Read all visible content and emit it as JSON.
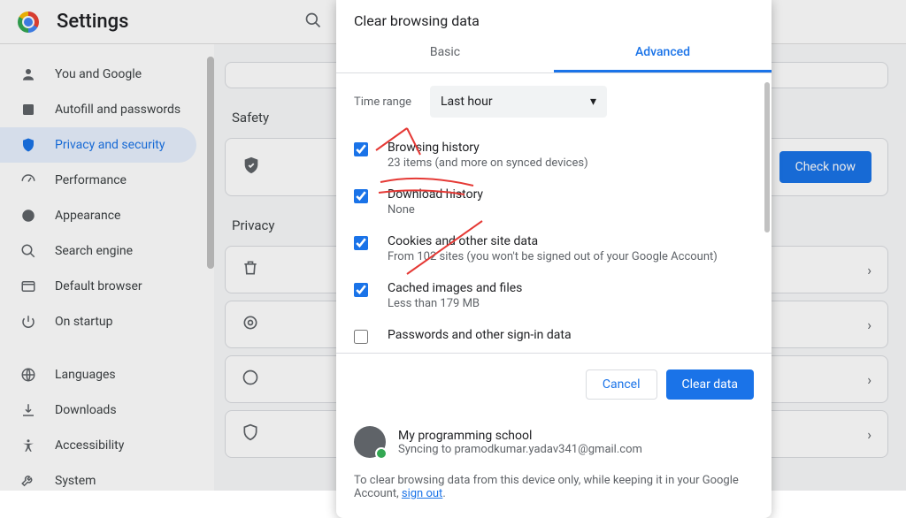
{
  "header": {
    "title": "Settings"
  },
  "sidebar": {
    "items": [
      {
        "label": "You and Google"
      },
      {
        "label": "Autofill and passwords"
      },
      {
        "label": "Privacy and security"
      },
      {
        "label": "Performance"
      },
      {
        "label": "Appearance"
      },
      {
        "label": "Search engine"
      },
      {
        "label": "Default browser"
      },
      {
        "label": "On startup"
      },
      {
        "label": "Languages"
      },
      {
        "label": "Downloads"
      },
      {
        "label": "Accessibility"
      },
      {
        "label": "System"
      }
    ]
  },
  "content": {
    "safety_label": "Safety",
    "check_now": "Check now",
    "privacy_label": "Privacy"
  },
  "modal": {
    "title": "Clear browsing data",
    "tab_basic": "Basic",
    "tab_advanced": "Advanced",
    "time_label": "Time range",
    "time_selected": "Last hour",
    "options": [
      {
        "label": "Browsing history",
        "sub": "23 items (and more on synced devices)",
        "checked": true
      },
      {
        "label": "Download history",
        "sub": "None",
        "checked": true
      },
      {
        "label": "Cookies and other site data",
        "sub": "From 102 sites (you won't be signed out of your Google Account)",
        "checked": true
      },
      {
        "label": "Cached images and files",
        "sub": "Less than 179 MB",
        "checked": true
      },
      {
        "label": "Passwords and other sign-in data",
        "sub": "",
        "checked": false
      }
    ],
    "cancel": "Cancel",
    "clear": "Clear data",
    "sync_name": "My programming school",
    "sync_sub": "Syncing to pramodkumar.yadav341@gmail.com",
    "note_pre": "To clear browsing data from this device only, while keeping it in your Google Account, ",
    "note_link": "sign out",
    "note_post": "."
  }
}
